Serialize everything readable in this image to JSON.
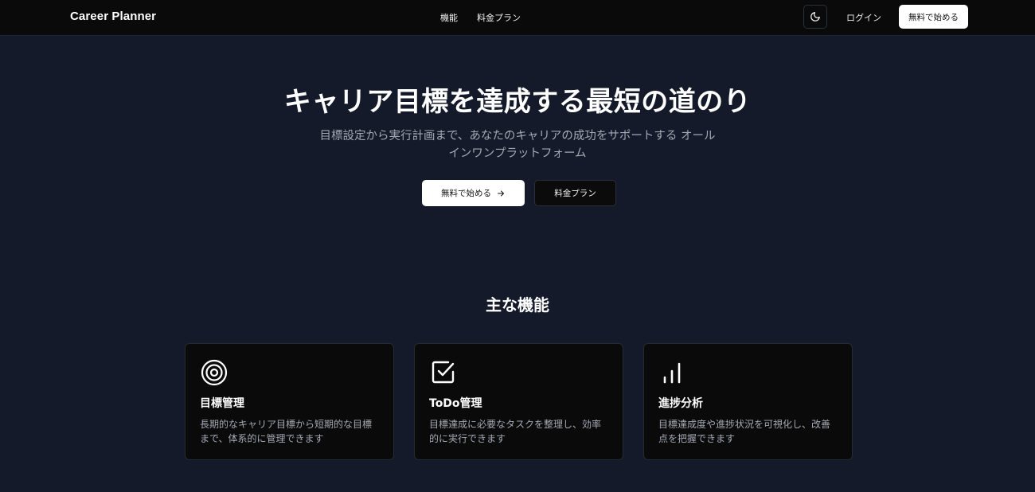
{
  "header": {
    "brand": "Career Planner",
    "nav": [
      {
        "label": "機能"
      },
      {
        "label": "料金プラン"
      }
    ],
    "theme_icon": "moon-icon",
    "login_label": "ログイン",
    "start_label": "無料で始める"
  },
  "hero": {
    "title": "キャリア目標を達成する最短の道のり",
    "subtitle": "目標設定から実行計画まで、あなたのキャリアの成功をサポートする オールインワンプラットフォーム",
    "primary_label": "無料で始める",
    "primary_icon": "arrow-right-icon",
    "secondary_label": "料金プラン"
  },
  "features": {
    "title": "主な機能",
    "cards": [
      {
        "icon": "target-icon",
        "title": "目標管理",
        "description": "長期的なキャリア目標から短期的な目標まで、体系的に管理できます"
      },
      {
        "icon": "checkbox-icon",
        "title": "ToDo管理",
        "description": "目標達成に必要なタスクを整理し、効率的に実行できます"
      },
      {
        "icon": "bar-chart-icon",
        "title": "進捗分析",
        "description": "目標達成度や進捗状況を可視化し、改善点を把握できます"
      }
    ]
  },
  "colors": {
    "page_background": "#141a2a",
    "header_background": "#0a0a0a",
    "card_background": "#0a0a0a",
    "text_muted": "#a3a8b3"
  }
}
